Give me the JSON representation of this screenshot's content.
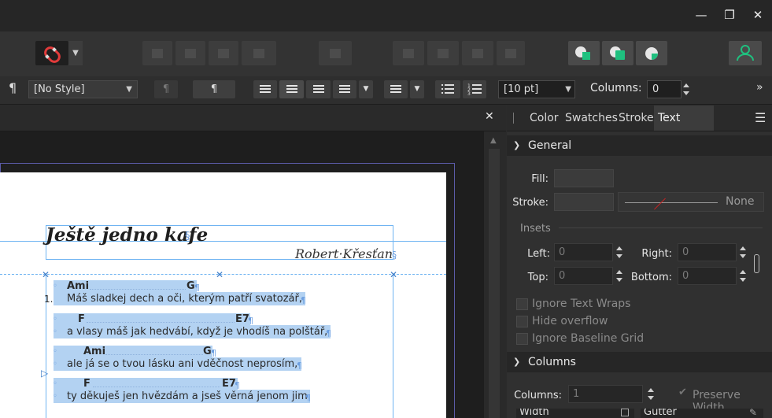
{
  "window_controls": {
    "minimize": "—",
    "restore": "❐",
    "close": "✕"
  },
  "context_bar": {
    "paragraph_icon": "¶",
    "style_dropdown": "[No Style]",
    "pilcrow_button": "¶",
    "font_size": "[10 pt]",
    "columns_label": "Columns:",
    "columns_value": "0",
    "overflow": "»"
  },
  "doc": {
    "close": "✕",
    "title": "Ještě jedno kafe",
    "title_mark": "§",
    "author": "Robert·Křesťan",
    "author_mark": "§",
    "list_number": "1.",
    "pilcrow": "¶",
    "bullet": "◦",
    "lines": [
      {
        "chord_a": "Ami",
        "chord_b": "G"
      },
      {
        "lyric": "Máš sladkej dech a oči, kterým patří svatozář,"
      },
      {
        "chord_a": "F",
        "chord_b": "E7"
      },
      {
        "lyric": "a vlasy máš jak hedvábí, když je vhodíš na polštář,"
      },
      {
        "chord_a": "Ami",
        "chord_b": "G"
      },
      {
        "lyric": "ale já se o tvou lásku ani vděčnost neprosím,"
      },
      {
        "chord_a": "F",
        "chord_b": "E7"
      },
      {
        "lyric": "ty děkuješ jen hvězdám a jseš věrná jenom jim"
      }
    ]
  },
  "panel": {
    "tabs": [
      "Color",
      "Swatches",
      "Stroke",
      "Text Frame"
    ],
    "active_tab": "Text Frame",
    "menu_icon": "☰",
    "general": {
      "title": "General",
      "fill_label": "Fill:",
      "stroke_label": "Stroke:",
      "none_label": "None",
      "insets_label": "Insets",
      "left_label": "Left:",
      "left_value": "0",
      "right_label": "Right:",
      "right_value": "0",
      "top_label": "Top:",
      "top_value": "0",
      "bottom_label": "Bottom:",
      "bottom_value": "0",
      "ignore_text_wraps": "Ignore Text Wraps",
      "hide_overflow": "Hide overflow",
      "ignore_baseline_grid": "Ignore Baseline Grid"
    },
    "columns": {
      "title": "Columns",
      "columns_label": "Columns:",
      "columns_value": "1",
      "preserve_width": "Preserve Width",
      "width_label": "Width",
      "gutter_label": "Gutter"
    }
  },
  "colors": {
    "accent_green": "#1fc07f",
    "selection": "#b3d2f2",
    "guide": "#6fb4f2"
  }
}
